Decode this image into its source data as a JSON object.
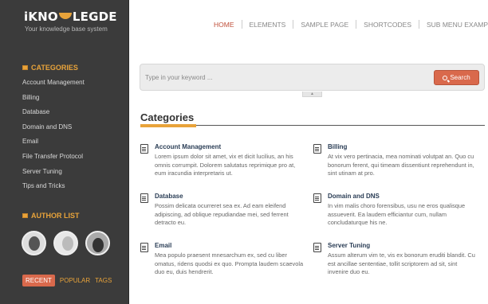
{
  "brand": {
    "logo_left": "iKNO",
    "logo_right": "LEGDE",
    "tagline": "Your knowledge base system"
  },
  "sidebar": {
    "categories_title": "CATEGORIES",
    "categories": [
      "Account Management",
      "Billing",
      "Database",
      "Domain and DNS",
      "Email",
      "File Transfer Protocol",
      "Server Tuning",
      "Tips and Tricks"
    ],
    "author_title": "AUTHOR LIST",
    "tabs": [
      "RECENT",
      "POPULAR",
      "TAGS"
    ]
  },
  "nav": [
    "HOME",
    "ELEMENTS",
    "SAMPLE PAGE",
    "SHORTCODES",
    "SUB MENU EXAMPLE"
  ],
  "search": {
    "placeholder": "Type in your keyword ...",
    "button_label": "Search"
  },
  "main": {
    "title": "Categories",
    "cards": [
      {
        "title": "Account Management",
        "desc": "Lorem ipsum dolor sit amet, vix et dicit lucilius, an his omnis corrumpit. Dolorem salutatus reprimique pro at, eum iracundia interpretaris ut."
      },
      {
        "title": "Billing",
        "desc": "At vix vero pertinacia, mea nominati volutpat an. Quo cu bonorum ferent, qui timeam dissentiunt reprehendunt in, sint utinam at pro."
      },
      {
        "title": "Database",
        "desc": "Possim delicata ocurreret sea ex. Ad eam eleifend adipiscing, ad oblique repudiandae mei, sed ferrent detracto eu."
      },
      {
        "title": "Domain and DNS",
        "desc": "In vim malis choro forensibus, usu ne eros qualisque assueverit. Ea laudem efficiantur cum, nullam concludaturque his ne."
      },
      {
        "title": "Email",
        "desc": "Mea populo praesent mnesarchum ex, sed cu liber omatus, ridens quodsi ex quo. Prompta laudem scaevola duo eu, duis hendrerit."
      },
      {
        "title": "Server Tuning",
        "desc": "Assum alterum vim te, vis ex bonorum eruditi blandit. Cu est ancillae sententiae, tollit scriptorem ad sit, sint invenire duo eu."
      }
    ]
  },
  "colors": {
    "accent": "#e8a33a",
    "button": "#d9694c",
    "sidebar": "#3b3b3b"
  }
}
